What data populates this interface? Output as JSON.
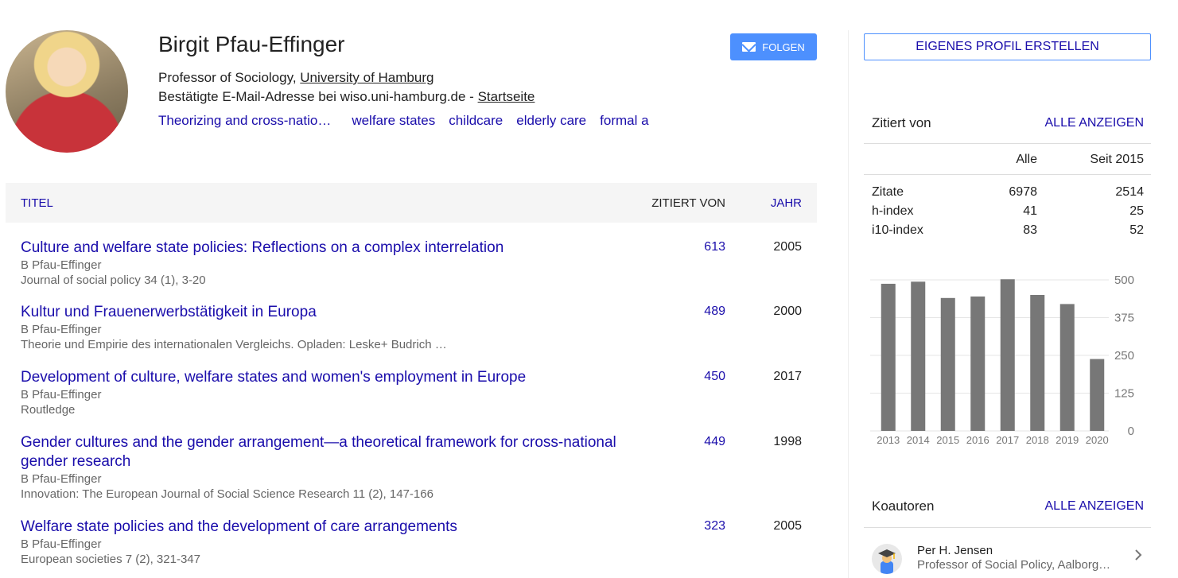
{
  "profile": {
    "name": "Birgit Pfau-Effinger",
    "affiliation_prefix": "Professor of Sociology, ",
    "affiliation_link": "University of Hamburg",
    "email_text": "Bestätigte E-Mail-Adresse bei wiso.uni-hamburg.de - ",
    "homepage_link": "Startseite",
    "interests": [
      "Theorizing and cross-natio…",
      "welfare states",
      "childcare",
      "elderly care",
      "formal a"
    ],
    "follow_label": "FOLGEN"
  },
  "table": {
    "col_title": "TITEL",
    "col_cited": "ZITIERT VON",
    "col_year": "JAHR",
    "rows": [
      {
        "title": "Culture and welfare state policies: Reflections on a complex interrelation",
        "authors": "B Pfau-Effinger",
        "venue": "Journal of social policy 34 (1), 3-20",
        "cites": "613",
        "year": "2005"
      },
      {
        "title": "Kultur und Frauenerwerbstätigkeit in Europa",
        "authors": "B Pfau-Effinger",
        "venue": "Theorie und Empirie des internationalen Vergleichs. Opladen: Leske+ Budrich …",
        "cites": "489",
        "year": "2000"
      },
      {
        "title": "Development of culture, welfare states and women's employment in Europe",
        "authors": "B Pfau-Effinger",
        "venue": "Routledge",
        "cites": "450",
        "year": "2017"
      },
      {
        "title": "Gender cultures and the gender arrangement—a theoretical framework for cross-national gender research",
        "authors": "B Pfau-Effinger",
        "venue": "Innovation: The European Journal of Social Science Research 11 (2), 147-166",
        "cites": "449",
        "year": "1998"
      },
      {
        "title": "Welfare state policies and the development of care arrangements",
        "authors": "B Pfau-Effinger",
        "venue": "European societies 7 (2), 321-347",
        "cites": "323",
        "year": "2005"
      }
    ]
  },
  "sidebar": {
    "own_profile_label": "EIGENES PROFIL ERSTELLEN",
    "cited_by": {
      "label": "Zitiert von",
      "show_all": "ALLE ANZEIGEN",
      "col_all": "Alle",
      "col_since": "Seit 2015",
      "rows": [
        {
          "key": "Zitate",
          "all": "6978",
          "since": "2514"
        },
        {
          "key": "h-index",
          "all": "41",
          "since": "25"
        },
        {
          "key": "i10-index",
          "all": "83",
          "since": "52"
        }
      ]
    },
    "coauthors": {
      "label": "Koautoren",
      "show_all": "ALLE ANZEIGEN",
      "items": [
        {
          "name": "Per H. Jensen",
          "affiliation": "Professor of Social Policy, Aalborg University"
        }
      ]
    }
  },
  "chart_data": {
    "type": "bar",
    "categories": [
      "2013",
      "2014",
      "2015",
      "2016",
      "2017",
      "2018",
      "2019",
      "2020"
    ],
    "values": [
      487,
      494,
      440,
      445,
      502,
      450,
      420,
      238
    ],
    "yticks": [
      "0",
      "125",
      "250",
      "375",
      "500"
    ],
    "ylim": [
      0,
      500
    ],
    "bar_color": "#777777",
    "grid": true
  }
}
